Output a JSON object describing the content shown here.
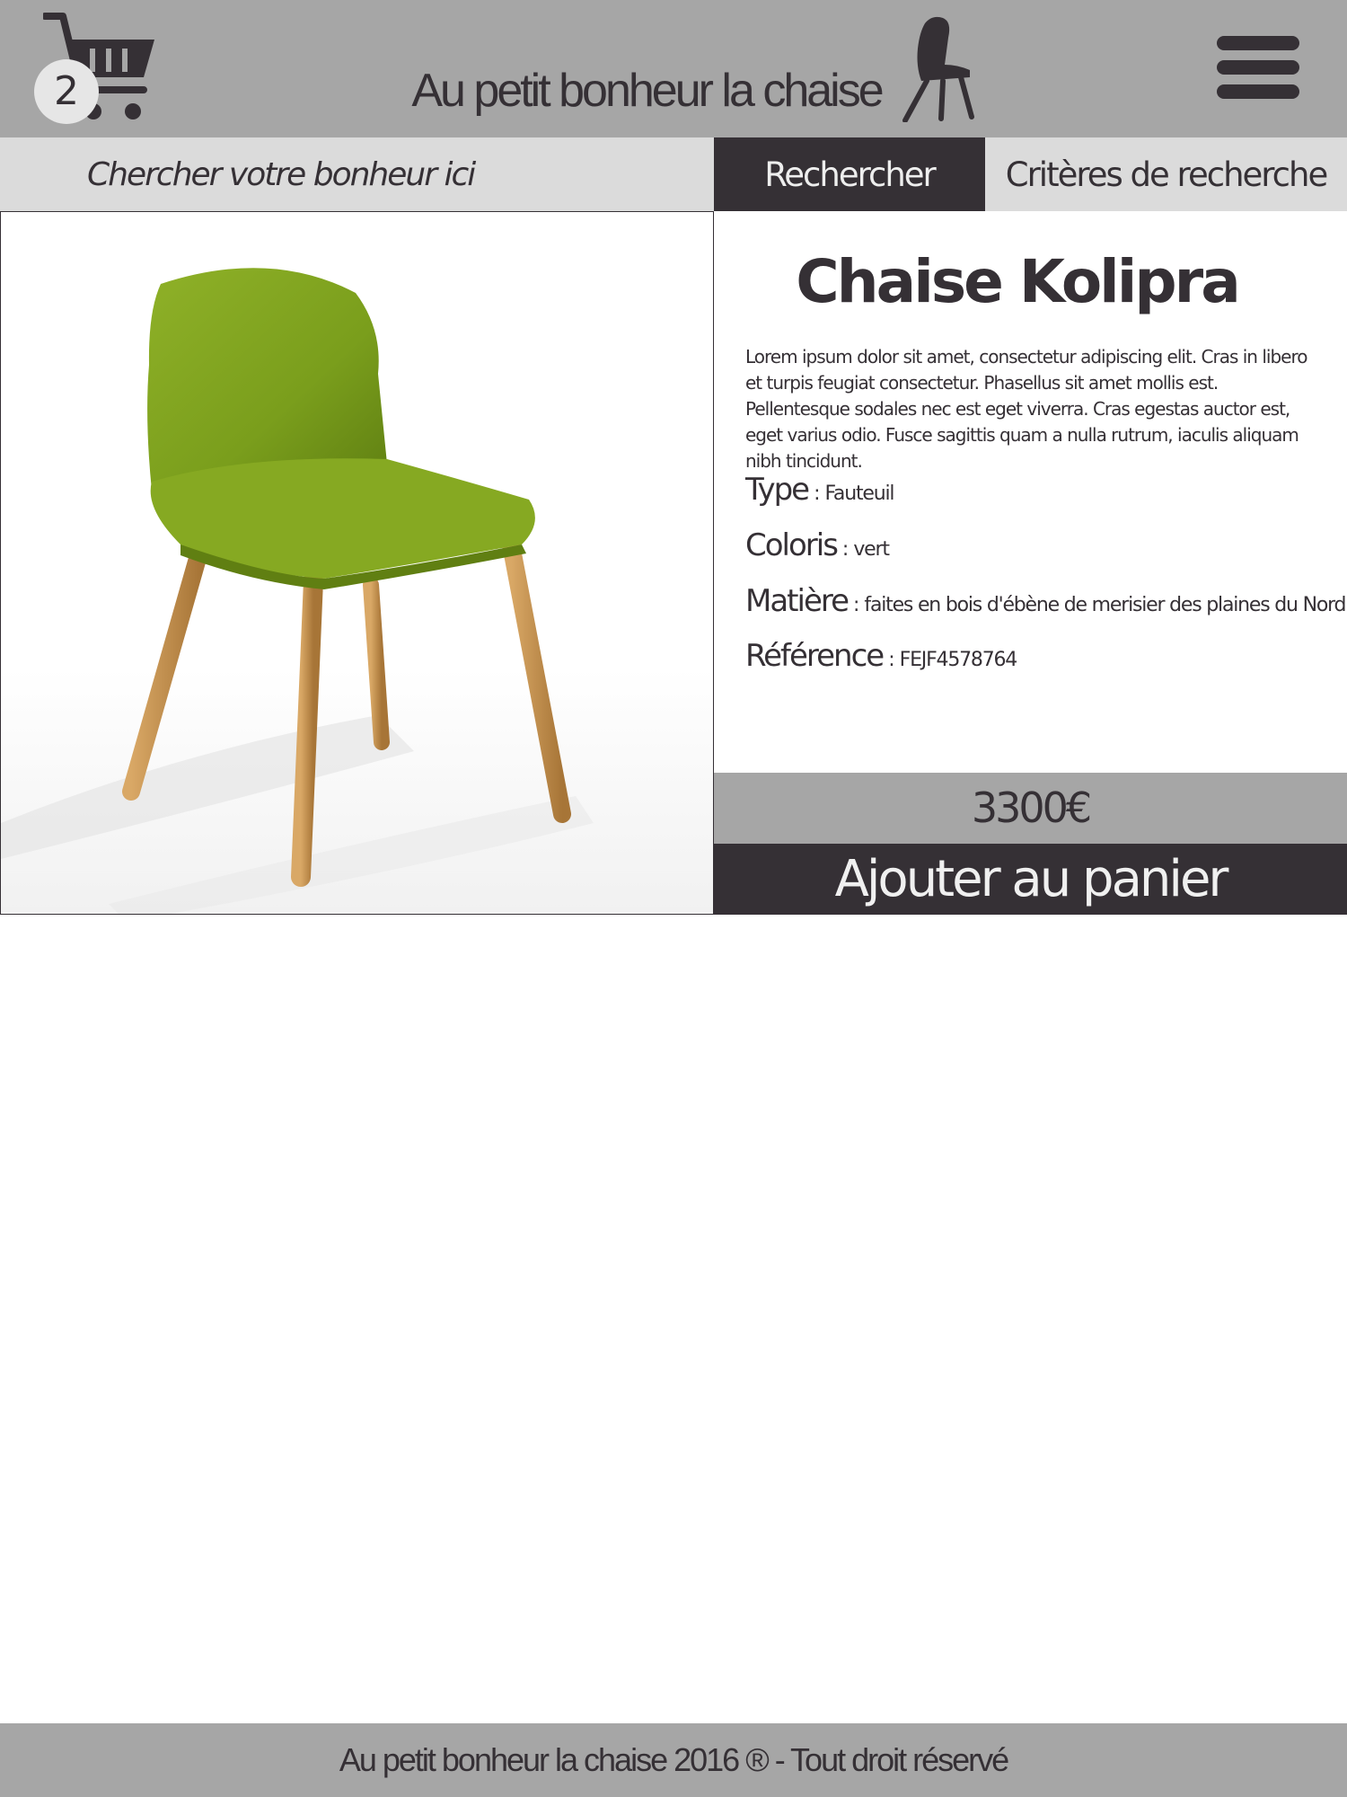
{
  "header": {
    "cart_count": "2",
    "site_title": "Au petit bonheur la chaise",
    "icons": {
      "cart": "cart-icon",
      "logo": "chair-logo-icon",
      "menu": "hamburger-menu-icon"
    }
  },
  "search": {
    "placeholder": "Chercher votre bonheur ici",
    "search_button": "Rechercher",
    "criteria_button": "Critères de recherche"
  },
  "product": {
    "name": "Chaise Kolipra",
    "description": "Lorem ipsum dolor sit amet, consectetur adipiscing elit. Cras in libero et turpis feugiat consectetur. Phasellus sit amet mollis est. Pellentesque sodales nec est eget viverra. Cras egestas auctor est, eget varius odio. Fusce sagittis quam a nulla rutrum, iaculis aliquam nibh tincidunt.",
    "attributes": [
      {
        "label": "Type",
        "value": "Fauteuil"
      },
      {
        "label": "Coloris",
        "value": "vert"
      },
      {
        "label": "Matière",
        "value": "faites en bois d'ébène de merisier des plaines du Nord"
      },
      {
        "label": "Référence",
        "value": "FEJF4578764"
      }
    ],
    "separator": " : ",
    "price": "3300€",
    "add_to_cart": "Ajouter au panier",
    "seat_color": "#7a9e1c",
    "leg_color": "#c08d4e"
  },
  "footer": {
    "text": "Au petit bonheur la chaise 2016 ® - Tout droit réservé"
  },
  "colors": {
    "header_bg": "#a6a6a6",
    "dark": "#353035",
    "light_gray": "#dbdbdb"
  }
}
